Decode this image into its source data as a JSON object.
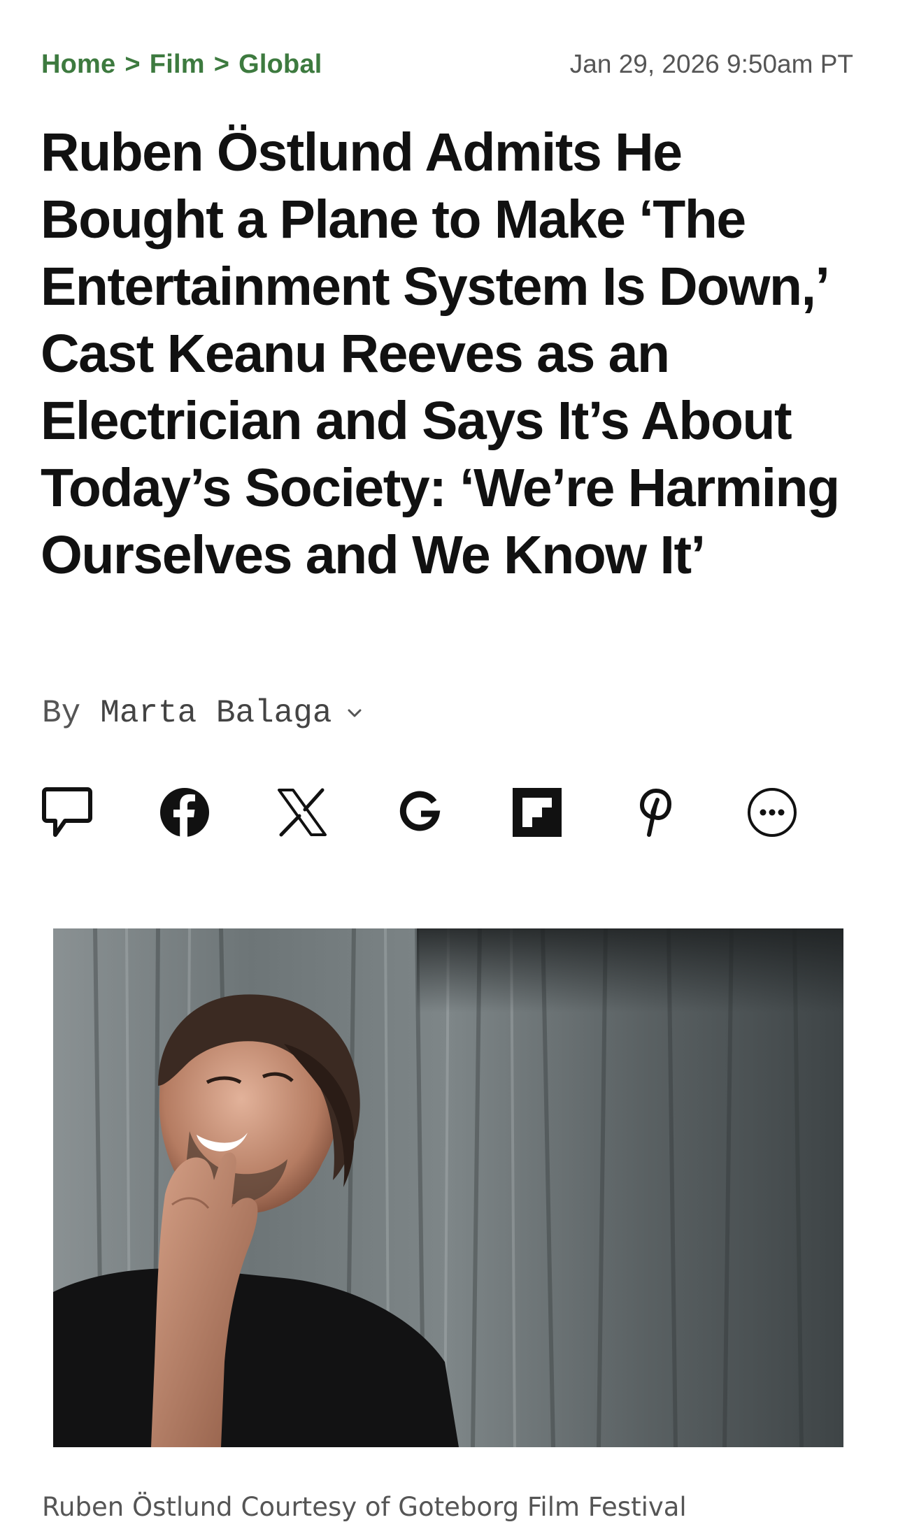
{
  "breadcrumb": {
    "items": [
      {
        "label": "Home"
      },
      {
        "label": "Film"
      },
      {
        "label": "Global"
      }
    ],
    "separator": ">"
  },
  "timestamp": "Jan 29, 2026 9:50am PT",
  "article": {
    "headline": "Ruben Östlund Admits He Bought a Plane to Make ‘The Entertainment System Is Down,’ Cast Keanu Reeves as an Electrician and Says It’s About Today’s Society: ‘We’re Harming Ourselves and We Know It’",
    "byline": {
      "prefix": "By",
      "author": "Marta Balaga"
    }
  },
  "share": [
    {
      "icon": "comment-icon"
    },
    {
      "icon": "facebook-icon"
    },
    {
      "icon": "x-icon"
    },
    {
      "icon": "google-icon"
    },
    {
      "icon": "flipboard-icon"
    },
    {
      "icon": "pinterest-icon"
    },
    {
      "icon": "more-icon"
    }
  ],
  "hero": {
    "caption": "Ruben Östlund",
    "credit": "Courtesy of Goteborg Film Festival"
  },
  "colors": {
    "accent": "#3d7a3f",
    "text": "#111111",
    "muted": "#555555"
  }
}
